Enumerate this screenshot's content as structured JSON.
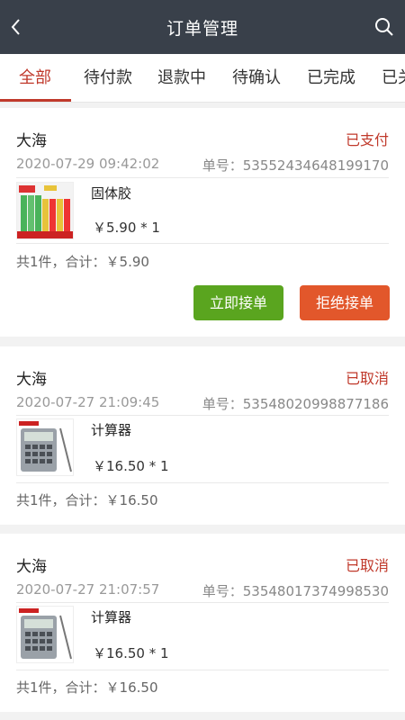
{
  "header": {
    "title": "订单管理",
    "back_icon": "chevron-left-icon",
    "search_icon": "search-icon"
  },
  "tabs": [
    {
      "label": "全部",
      "active": true
    },
    {
      "label": "待付款",
      "active": false
    },
    {
      "label": "退款中",
      "active": false
    },
    {
      "label": "待确认",
      "active": false
    },
    {
      "label": "已完成",
      "active": false
    },
    {
      "label": "已关",
      "active": false
    }
  ],
  "orders": [
    {
      "name": "大海",
      "status": "已支付",
      "date": "2020-07-29 09:42:02",
      "order_no": "单号：53552434648199170",
      "product_name": "固体胶",
      "price": "￥5.90 * 1",
      "total": "共1件，合计：￥5.90",
      "accept_label": "立即接单",
      "reject_label": "拒绝接单"
    },
    {
      "name": "大海",
      "status": "已取消",
      "date": "2020-07-27 21:09:45",
      "order_no": "单号：53548020998877186",
      "product_name": "计算器",
      "price": "￥16.50 * 1",
      "total": "共1件，合计：￥16.50"
    },
    {
      "name": "大海",
      "status": "已取消",
      "date": "2020-07-27 21:07:57",
      "order_no": "单号：53548017374998530",
      "product_name": "计算器",
      "price": "￥16.50 * 1",
      "total": "共1件，合计：￥16.50"
    }
  ],
  "colors": {
    "header_bg": "#39404a",
    "accent": "#c0392b",
    "accept": "#5aa51f",
    "reject": "#e2572b"
  }
}
